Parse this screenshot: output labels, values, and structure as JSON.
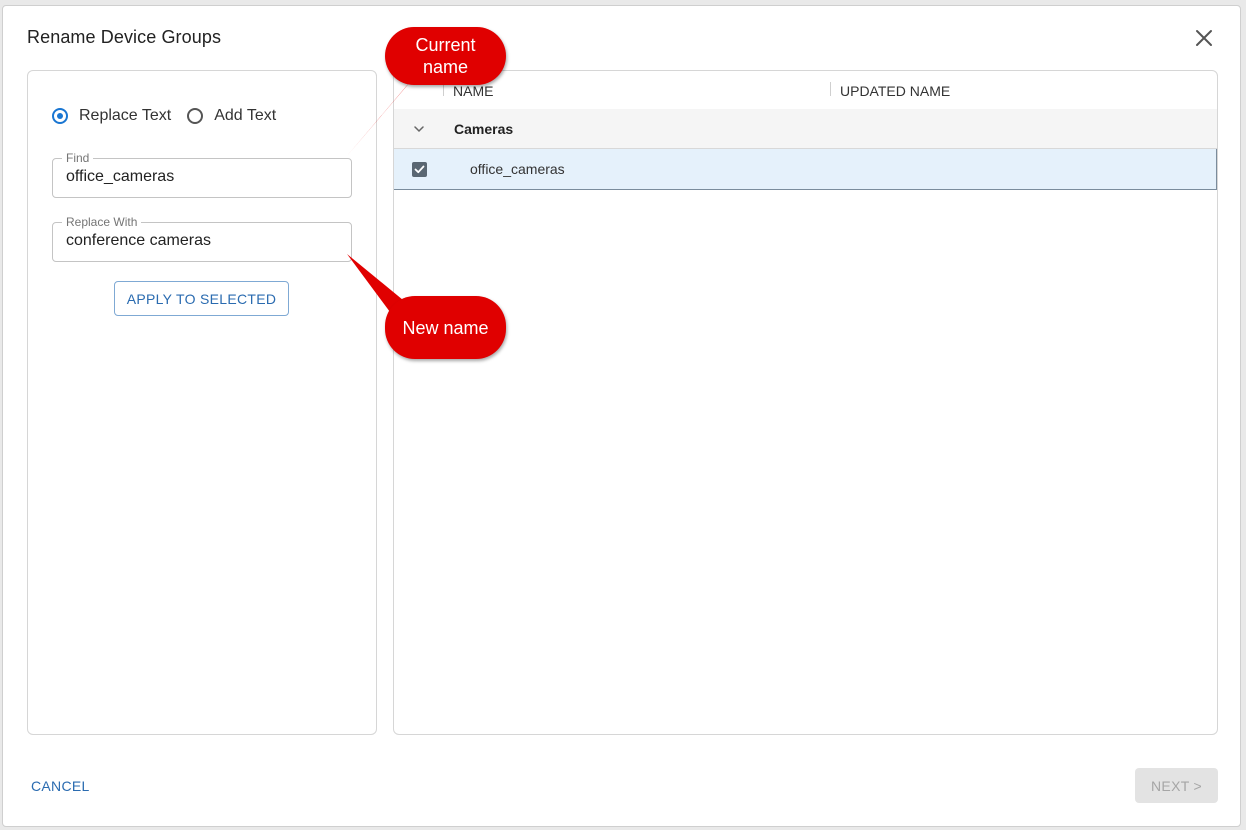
{
  "dialog": {
    "title": "Rename Device Groups"
  },
  "left": {
    "radio": [
      {
        "label": "Replace Text",
        "checked": true
      },
      {
        "label": "Add Text",
        "checked": false
      }
    ],
    "find": {
      "label": "Find",
      "value": "office_cameras"
    },
    "replace": {
      "label": "Replace With",
      "value": "conference cameras"
    },
    "apply_label": "APPLY TO SELECTED"
  },
  "table": {
    "columns": [
      "NAME",
      "UPDATED NAME"
    ],
    "group": {
      "label": "Cameras",
      "expanded": true
    },
    "rows": [
      {
        "name": "office_cameras",
        "updated": "",
        "checked": true
      }
    ]
  },
  "footer": {
    "cancel_label": "CANCEL",
    "next_label": "NEXT >"
  },
  "annotations": {
    "current": "Current name",
    "new": "New name"
  },
  "colors": {
    "accent": "#1976d2",
    "callout": "#e00000",
    "selected_row": "#e5f1fb"
  }
}
